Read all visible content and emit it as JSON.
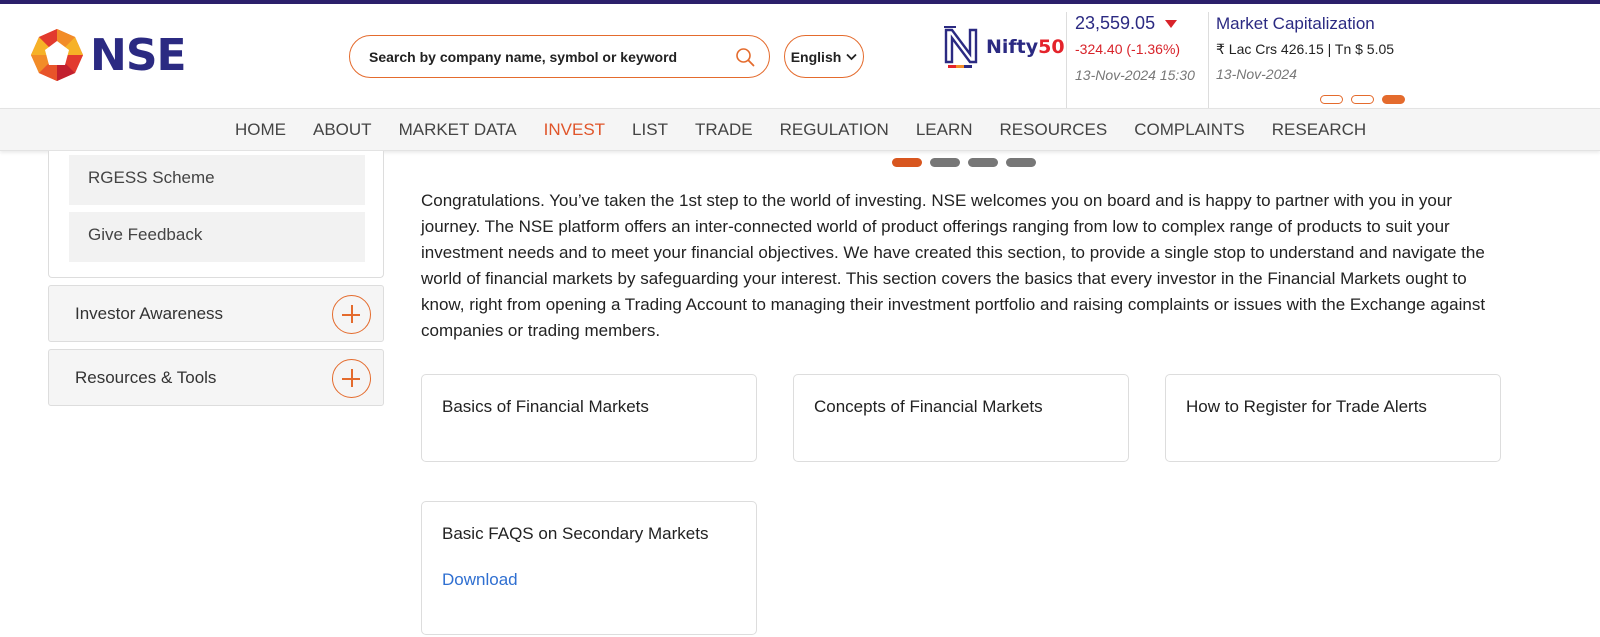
{
  "header": {
    "logo_text": "NSE",
    "search": {
      "placeholder": "Search by company name, symbol or keyword"
    },
    "language": "English",
    "nifty": {
      "logo_text": "Nifty",
      "logo_suffix": "50",
      "value": "23,559.05",
      "change": "-324.40 (-1.36%)",
      "date": "13-Nov-2024 15:30"
    },
    "market_cap": {
      "title": "Market Capitalization",
      "value": "₹ Lac Crs 426.15 | Tn $ 5.05",
      "date": "13-Nov-2024",
      "slides": 3,
      "active_slide": 3
    }
  },
  "nav": {
    "items": [
      "HOME",
      "ABOUT",
      "MARKET DATA",
      "INVEST",
      "LIST",
      "TRADE",
      "REGULATION",
      "LEARN",
      "RESOURCES",
      "COMPLAINTS",
      "RESEARCH"
    ],
    "active": "INVEST"
  },
  "sidebar": {
    "sub_items": [
      "RGESS Scheme",
      "Give Feedback"
    ],
    "accordions": [
      "Investor Awareness",
      "Resources & Tools"
    ]
  },
  "carousel": {
    "slides": 4,
    "active_slide": 1
  },
  "main": {
    "intro": "Congratulations. You’ve taken the 1st step to the world of investing. NSE welcomes you on board and is happy to partner with you in  your journey.  The NSE platform offers an inter-connected world of product offerings ranging from low to complex range of products to suit your investment needs and to meet your financial objectives.  We have created this section, to provide a single stop to understand and navigate the world of financial markets by safeguarding your interest. This section covers the basics that every investor in the Financial Markets ought to know, right from opening a Trading Account to managing their investment portfolio and raising complaints or issues with the Exchange against companies or trading members.",
    "cards": [
      {
        "title": "Basics of Financial Markets"
      },
      {
        "title": "Concepts of Financial Markets"
      },
      {
        "title": "How to Register for Trade Alerts"
      },
      {
        "title": "Basic FAQS on Secondary Markets",
        "link": "Download"
      }
    ]
  },
  "colors": {
    "brand": "#2b2a82",
    "accent": "#e46b2d",
    "negative": "#d8232a",
    "link": "#2f6fd1"
  }
}
